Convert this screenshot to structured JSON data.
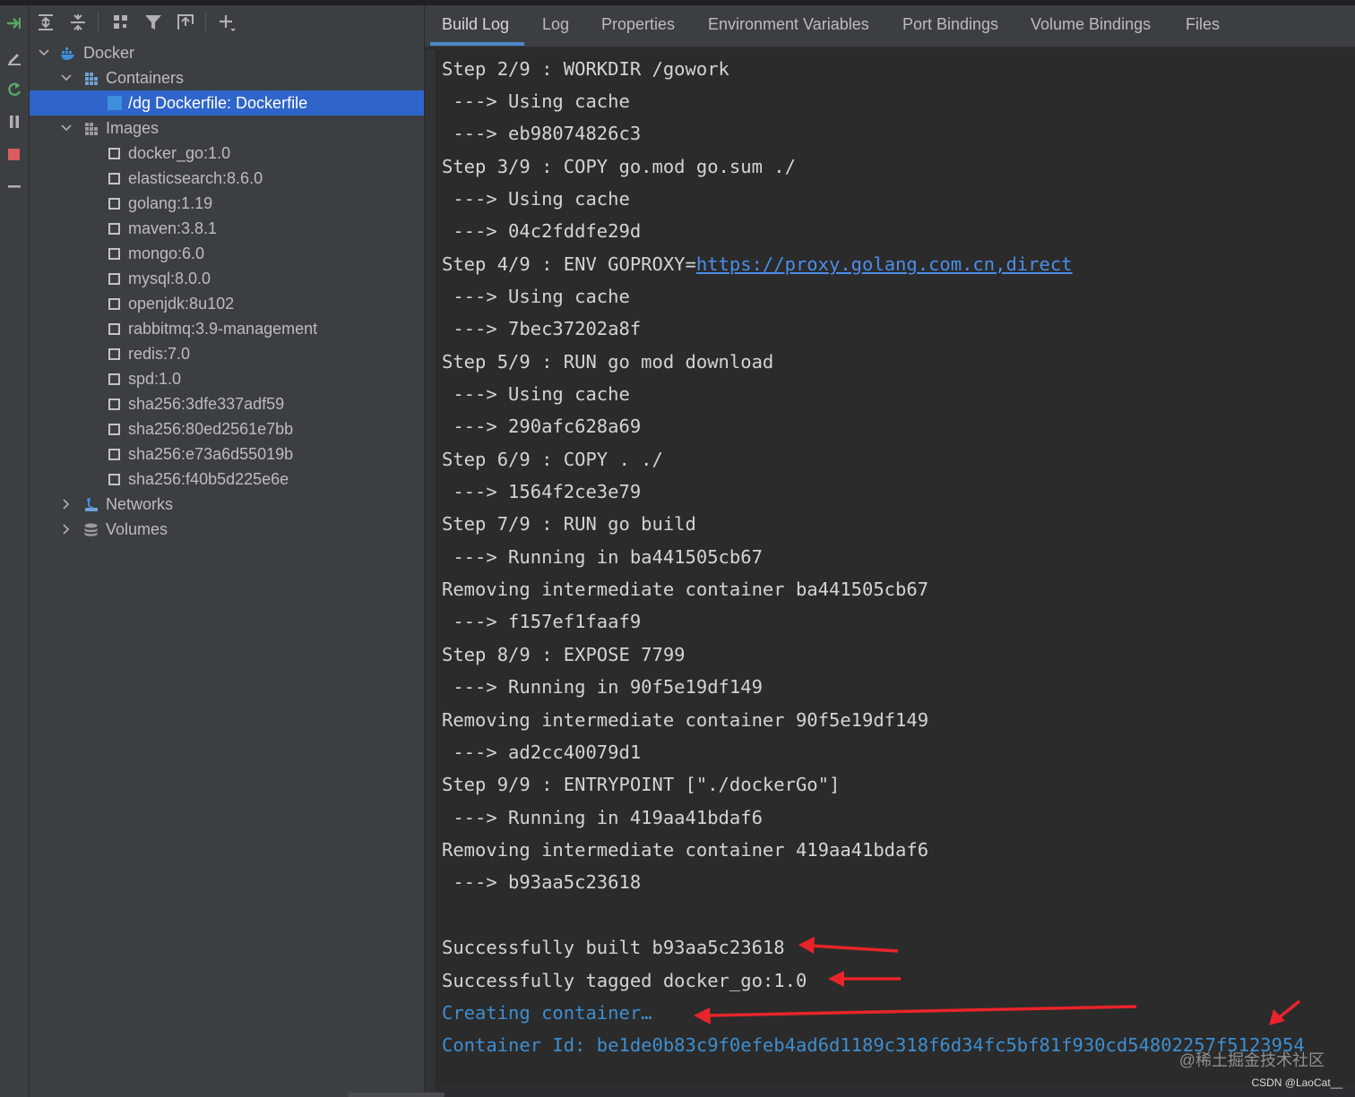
{
  "tabs": [
    {
      "label": "Build Log",
      "active": true
    },
    {
      "label": "Log"
    },
    {
      "label": "Properties"
    },
    {
      "label": "Environment Variables"
    },
    {
      "label": "Port Bindings"
    },
    {
      "label": "Volume Bindings"
    },
    {
      "label": "Files"
    }
  ],
  "tree": {
    "root": "Docker",
    "containers_label": "Containers",
    "container_item": "/dg Dockerfile: Dockerfile",
    "images_label": "Images",
    "images": [
      "docker_go:1.0",
      "elasticsearch:8.6.0",
      "golang:1.19",
      "maven:3.8.1",
      "mongo:6.0",
      "mysql:8.0.0",
      "openjdk:8u102",
      "rabbitmq:3.9-management",
      "redis:7.0",
      "spd:1.0",
      "sha256:3dfe337adf59",
      "sha256:80ed2561e7bb",
      "sha256:e73a6d55019b",
      "sha256:f40b5d225e6e"
    ],
    "networks_label": "Networks",
    "volumes_label": "Volumes"
  },
  "log": {
    "lines": [
      "Step 2/9 : WORKDIR /gowork",
      " ---> Using cache",
      " ---> eb98074826c3",
      "Step 3/9 : COPY go.mod go.sum ./",
      " ---> Using cache",
      " ---> 04c2fddfe29d",
      "Step 4/9 : ENV GOPROXY=",
      " ---> Using cache",
      " ---> 7bec37202a8f",
      "Step 5/9 : RUN go mod download",
      " ---> Using cache",
      " ---> 290afc628a69",
      "Step 6/9 : COPY . ./",
      " ---> 1564f2ce3e79",
      "Step 7/9 : RUN go build",
      " ---> Running in ba441505cb67",
      "Removing intermediate container ba441505cb67",
      " ---> f157ef1faaf9",
      "Step 8/9 : EXPOSE 7799",
      " ---> Running in 90f5e19df149",
      "Removing intermediate container 90f5e19df149",
      " ---> ad2cc40079d1",
      "Step 9/9 : ENTRYPOINT [\"./dockerGo\"]",
      " ---> Running in 419aa41bdaf6",
      "Removing intermediate container 419aa41bdaf6",
      " ---> b93aa5c23618",
      "",
      "Successfully built b93aa5c23618",
      "Successfully tagged docker_go:1.0",
      "Creating container…",
      "Container Id: be1de0b83c9f0efeb4ad6d1189c318f6d34fc5bf81f930cd54802257f5123954"
    ],
    "proxy_link": "https://proxy.golang.com.cn,direct"
  },
  "colors": {
    "accent": "#4a88c7",
    "selection": "#2f65ca",
    "annotation_red": "#e8242a",
    "status_blue": "#3e8ed0"
  },
  "watermarks": {
    "juejin": "@稀土掘金技术社区",
    "csdn": "CSDN @LaoCat__"
  }
}
